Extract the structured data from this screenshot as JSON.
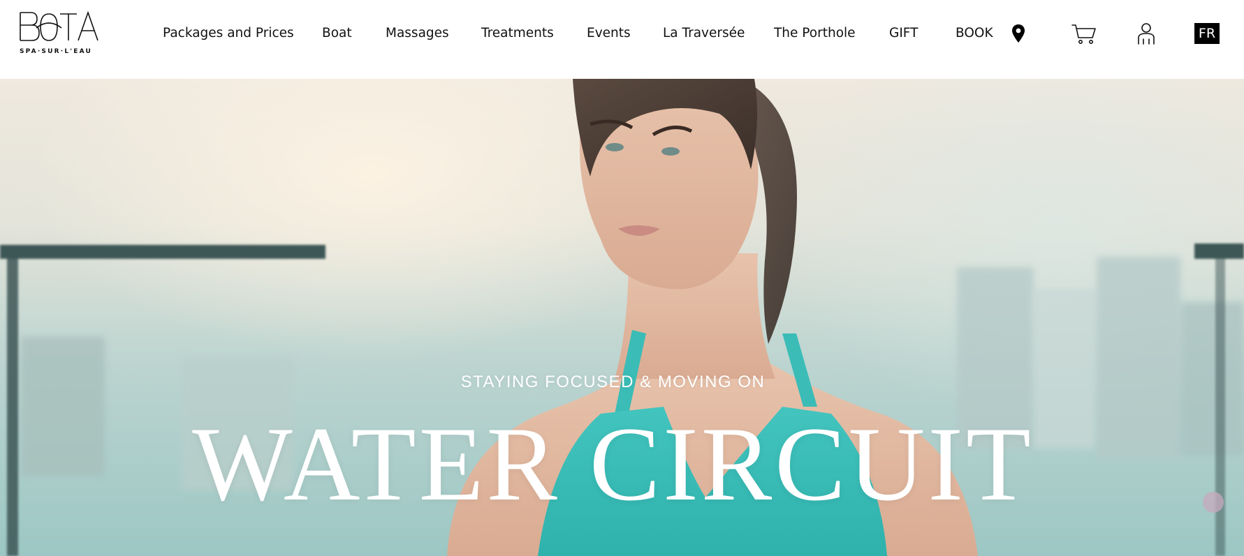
{
  "brand": {
    "logo_text": "BOTA",
    "tagline": "SPA·SUR·L'EAU"
  },
  "nav": {
    "items": [
      {
        "label": "Packages and Prices"
      },
      {
        "label": "Boat"
      },
      {
        "label": "Massages"
      },
      {
        "label": "Treatments"
      },
      {
        "label": "Events"
      },
      {
        "label": "La Traversée"
      },
      {
        "label": "The Porthole"
      },
      {
        "label": "GIFT"
      },
      {
        "label": "BOOK"
      }
    ],
    "icons": {
      "location": "map-pin-icon",
      "cart": "cart-icon",
      "account": "user-icon"
    },
    "language_toggle": "FR"
  },
  "hero": {
    "subtitle": "STAYING FOCUSED & MOVING ON",
    "title": "WATER CIRCUIT"
  },
  "colors": {
    "header_bg": "#ffffff",
    "text": "#111111",
    "lang_bg": "#000000",
    "hero_text": "#ffffff",
    "teal_top": "#3dbdb8"
  }
}
